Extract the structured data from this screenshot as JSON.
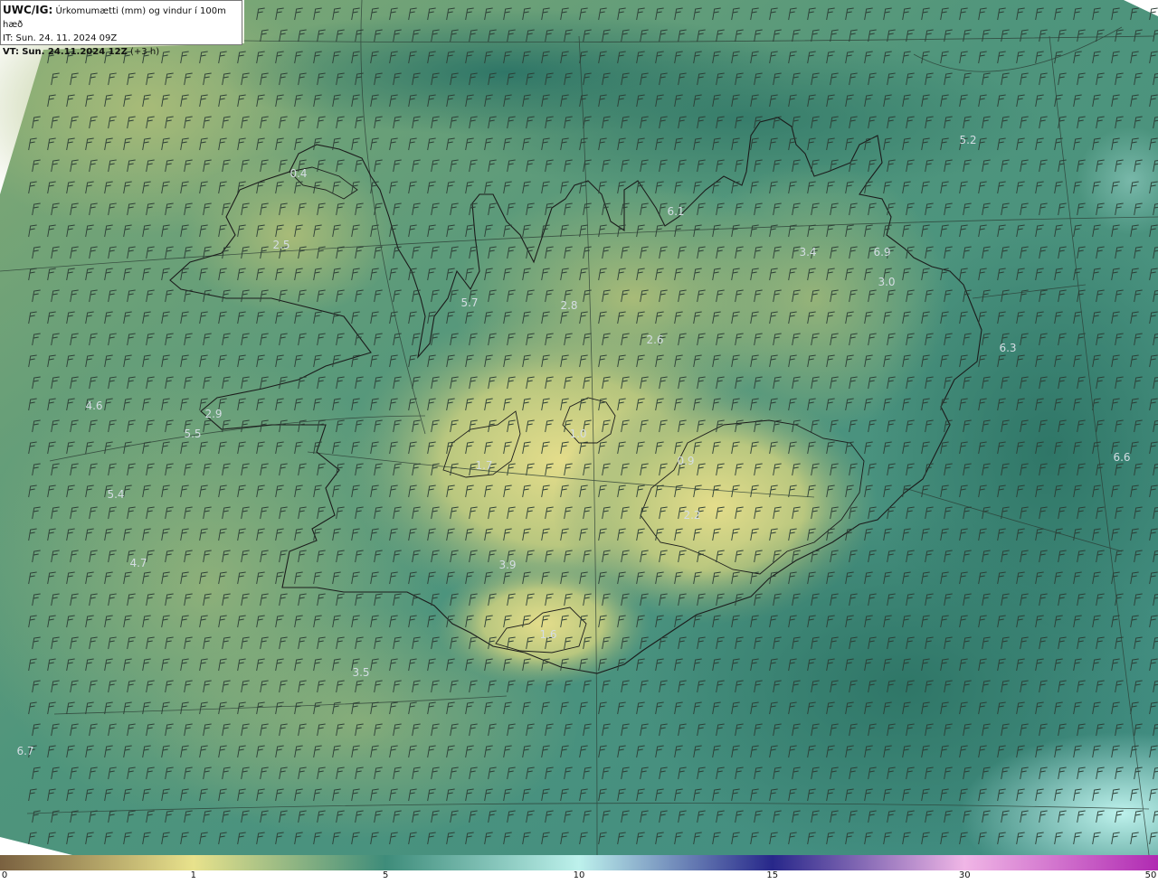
{
  "header": {
    "model": "UWC/IG:",
    "subtitle": "Úrkomumætti (mm) og vindur í 100m hæð",
    "issue_time": "IT: Sun. 24. 11. 2024 09Z",
    "valid_prefix": "VT:",
    "valid_time": "Sun. 24.11.2024 12Z",
    "lead_time": "(+3 h)"
  },
  "colors": {
    "brown": "#7a6140",
    "yellow": "#e8e28c",
    "teal": "#3e8c7a",
    "cyan": "#bdf1ec",
    "navy": "#27278a",
    "magenta": "#b02ab2",
    "coast": "#1b1b1b"
  },
  "colorbar": {
    "ticks": [
      {
        "label": "0",
        "value": 0
      },
      {
        "label": "1",
        "value": 1
      },
      {
        "label": "5",
        "value": 5
      },
      {
        "label": "10",
        "value": 10
      },
      {
        "label": "15",
        "value": 15
      },
      {
        "label": "30",
        "value": 30
      },
      {
        "label": "50",
        "value": 50
      }
    ]
  },
  "map": {
    "region": "Iceland",
    "wind_symbol": "wind-barb-icon",
    "point_values": [
      "5.2",
      "6.1",
      "3.4",
      "6.9",
      "3.0",
      "5.7",
      "2.8",
      "2.6",
      "6.3",
      "4.6",
      "2.9",
      "5.5",
      "1.0",
      "0.9",
      "6.6",
      "5.4",
      "4.7",
      "3.9",
      "3.5",
      "6.7",
      "0.4",
      "2.5",
      "1.7",
      "2.2",
      "1.6"
    ]
  }
}
